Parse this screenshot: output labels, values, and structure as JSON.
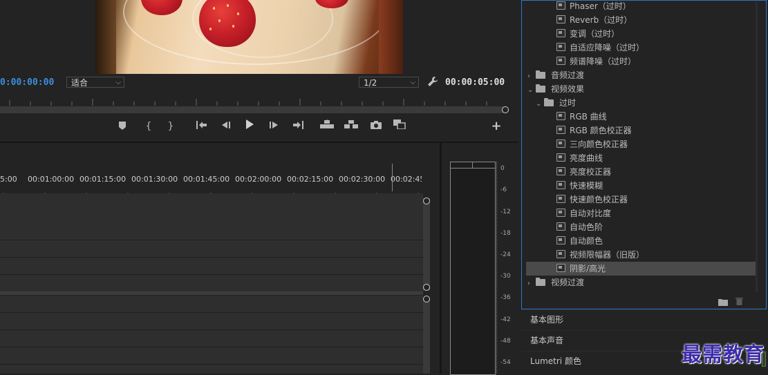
{
  "program_monitor": {
    "timecode_current": "0:00:00:00",
    "fit_select": "适合",
    "resolution_select": "1/2",
    "timecode_duration": "00:00:05:00",
    "controls": {
      "marker": "⛉",
      "mark_in": "{",
      "mark_out": "}",
      "go_to_in": "⇤",
      "step_back": "◀",
      "play": "▶",
      "step_forward": "▶",
      "go_to_out": "⇥",
      "lift": "▟",
      "extract": "▙",
      "export_frame": "📷",
      "compare": "▣",
      "add": "+"
    }
  },
  "timeline": {
    "ruler": [
      "5:00",
      "00:01:00:00",
      "00:01:15:00",
      "00:01:30:00",
      "00:01:45:00",
      "00:02:00:00",
      "00:02:15:00",
      "00:02:30:00",
      "00:02:45:"
    ]
  },
  "audio_meter": {
    "scale": [
      "0",
      "-6",
      "-12",
      "-18",
      "-24",
      "-30",
      "-36",
      "-42",
      "-48",
      "-54"
    ]
  },
  "effects_panel": {
    "items": [
      {
        "label": "Phaser（过时）",
        "kind": "effect",
        "indent": 2
      },
      {
        "label": "Reverb（过时）",
        "kind": "effect",
        "indent": 2
      },
      {
        "label": "变调（过时）",
        "kind": "effect",
        "indent": 2
      },
      {
        "label": "自适应降噪（过时）",
        "kind": "effect",
        "indent": 2
      },
      {
        "label": "频谱降噪（过时）",
        "kind": "effect",
        "indent": 2
      },
      {
        "label": "音频过渡",
        "kind": "folder",
        "indent": 0,
        "expanded": false
      },
      {
        "label": "视频效果",
        "kind": "folder",
        "indent": 0,
        "expanded": true
      },
      {
        "label": "过时",
        "kind": "folder",
        "indent": 1,
        "expanded": true
      },
      {
        "label": "RGB 曲线",
        "kind": "effect",
        "indent": 2
      },
      {
        "label": "RGB 颜色校正器",
        "kind": "effect",
        "indent": 2
      },
      {
        "label": "三向颜色校正器",
        "kind": "effect",
        "indent": 2
      },
      {
        "label": "亮度曲线",
        "kind": "effect",
        "indent": 2
      },
      {
        "label": "亮度校正器",
        "kind": "effect",
        "indent": 2
      },
      {
        "label": "快速模糊",
        "kind": "effect",
        "indent": 2
      },
      {
        "label": "快速颜色校正器",
        "kind": "effect",
        "indent": 2
      },
      {
        "label": "自动对比度",
        "kind": "effect",
        "indent": 2
      },
      {
        "label": "自动色阶",
        "kind": "effect",
        "indent": 2
      },
      {
        "label": "自动颜色",
        "kind": "effect",
        "indent": 2
      },
      {
        "label": "视频限幅器（旧版）",
        "kind": "effect",
        "indent": 2
      },
      {
        "label": "阴影/高光",
        "kind": "effect",
        "indent": 2,
        "selected": true
      },
      {
        "label": "视频过渡",
        "kind": "folder",
        "indent": 0,
        "expanded": false
      }
    ],
    "footer_icons": [
      "new-folder-icon",
      "trash-icon"
    ]
  },
  "side_panels": [
    "基本图形",
    "基本声音",
    "Lumetri 颜色"
  ],
  "watermark": "最需教育",
  "colors": {
    "accent": "#2e78c7",
    "timecode_blue": "#3b8fe0",
    "selected_row": "#4a4a4a"
  }
}
